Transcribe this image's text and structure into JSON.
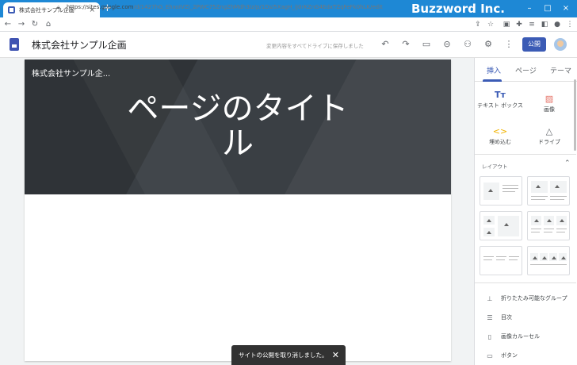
{
  "browser": {
    "tab_title": "株式会社サンプル企画",
    "tab_close": "×",
    "new_tab": "+",
    "brand": "Buzzword Inc.",
    "window_controls": [
      "–",
      "□",
      "×"
    ],
    "url_host": "https://sites.google.com",
    "url_path": "/d/1427hG_EhxoIVZI_2PWC75ZngZhMdh3Iz/p/1DsI5XagH_iJ0rKZnG4EdxTZqFeFk0hLK/edit",
    "nav_icons": [
      "back-icon",
      "forward-icon",
      "reload-icon",
      "home-icon"
    ]
  },
  "sites_header": {
    "site_title": "株式会社サンプル企画",
    "saved_status": "変更内容をすべてドライブに保存しました",
    "publish_label": "公開"
  },
  "page": {
    "banner_site_name": "株式会社サンプル企...",
    "title_line1": "ページのタイト",
    "title_line2": "ル"
  },
  "toast": {
    "message": "サイトの公開を取り消しました。",
    "close": "✕"
  },
  "panel": {
    "tabs": [
      "挿入",
      "ページ",
      "テーマ"
    ],
    "insert_items": [
      {
        "icon": "textbox-icon",
        "label": "テキスト ボックス"
      },
      {
        "icon": "image-icon",
        "label": "画像"
      },
      {
        "icon": "embed-icon",
        "label": "埋め込む"
      },
      {
        "icon": "drive-icon",
        "label": "ドライブ"
      }
    ],
    "layout_label": "レイアウト",
    "components": [
      {
        "icon": "collapsible-group-icon",
        "label": "折りたたみ可能なグループ"
      },
      {
        "icon": "toc-icon",
        "label": "目次"
      },
      {
        "icon": "carousel-icon",
        "label": "画像カルーセル"
      },
      {
        "icon": "button-icon",
        "label": "ボタン"
      }
    ]
  },
  "colors": {
    "chrome_blue": "#1e88d5",
    "accent": "#3b5bb5",
    "banner": "#3a3f44"
  }
}
